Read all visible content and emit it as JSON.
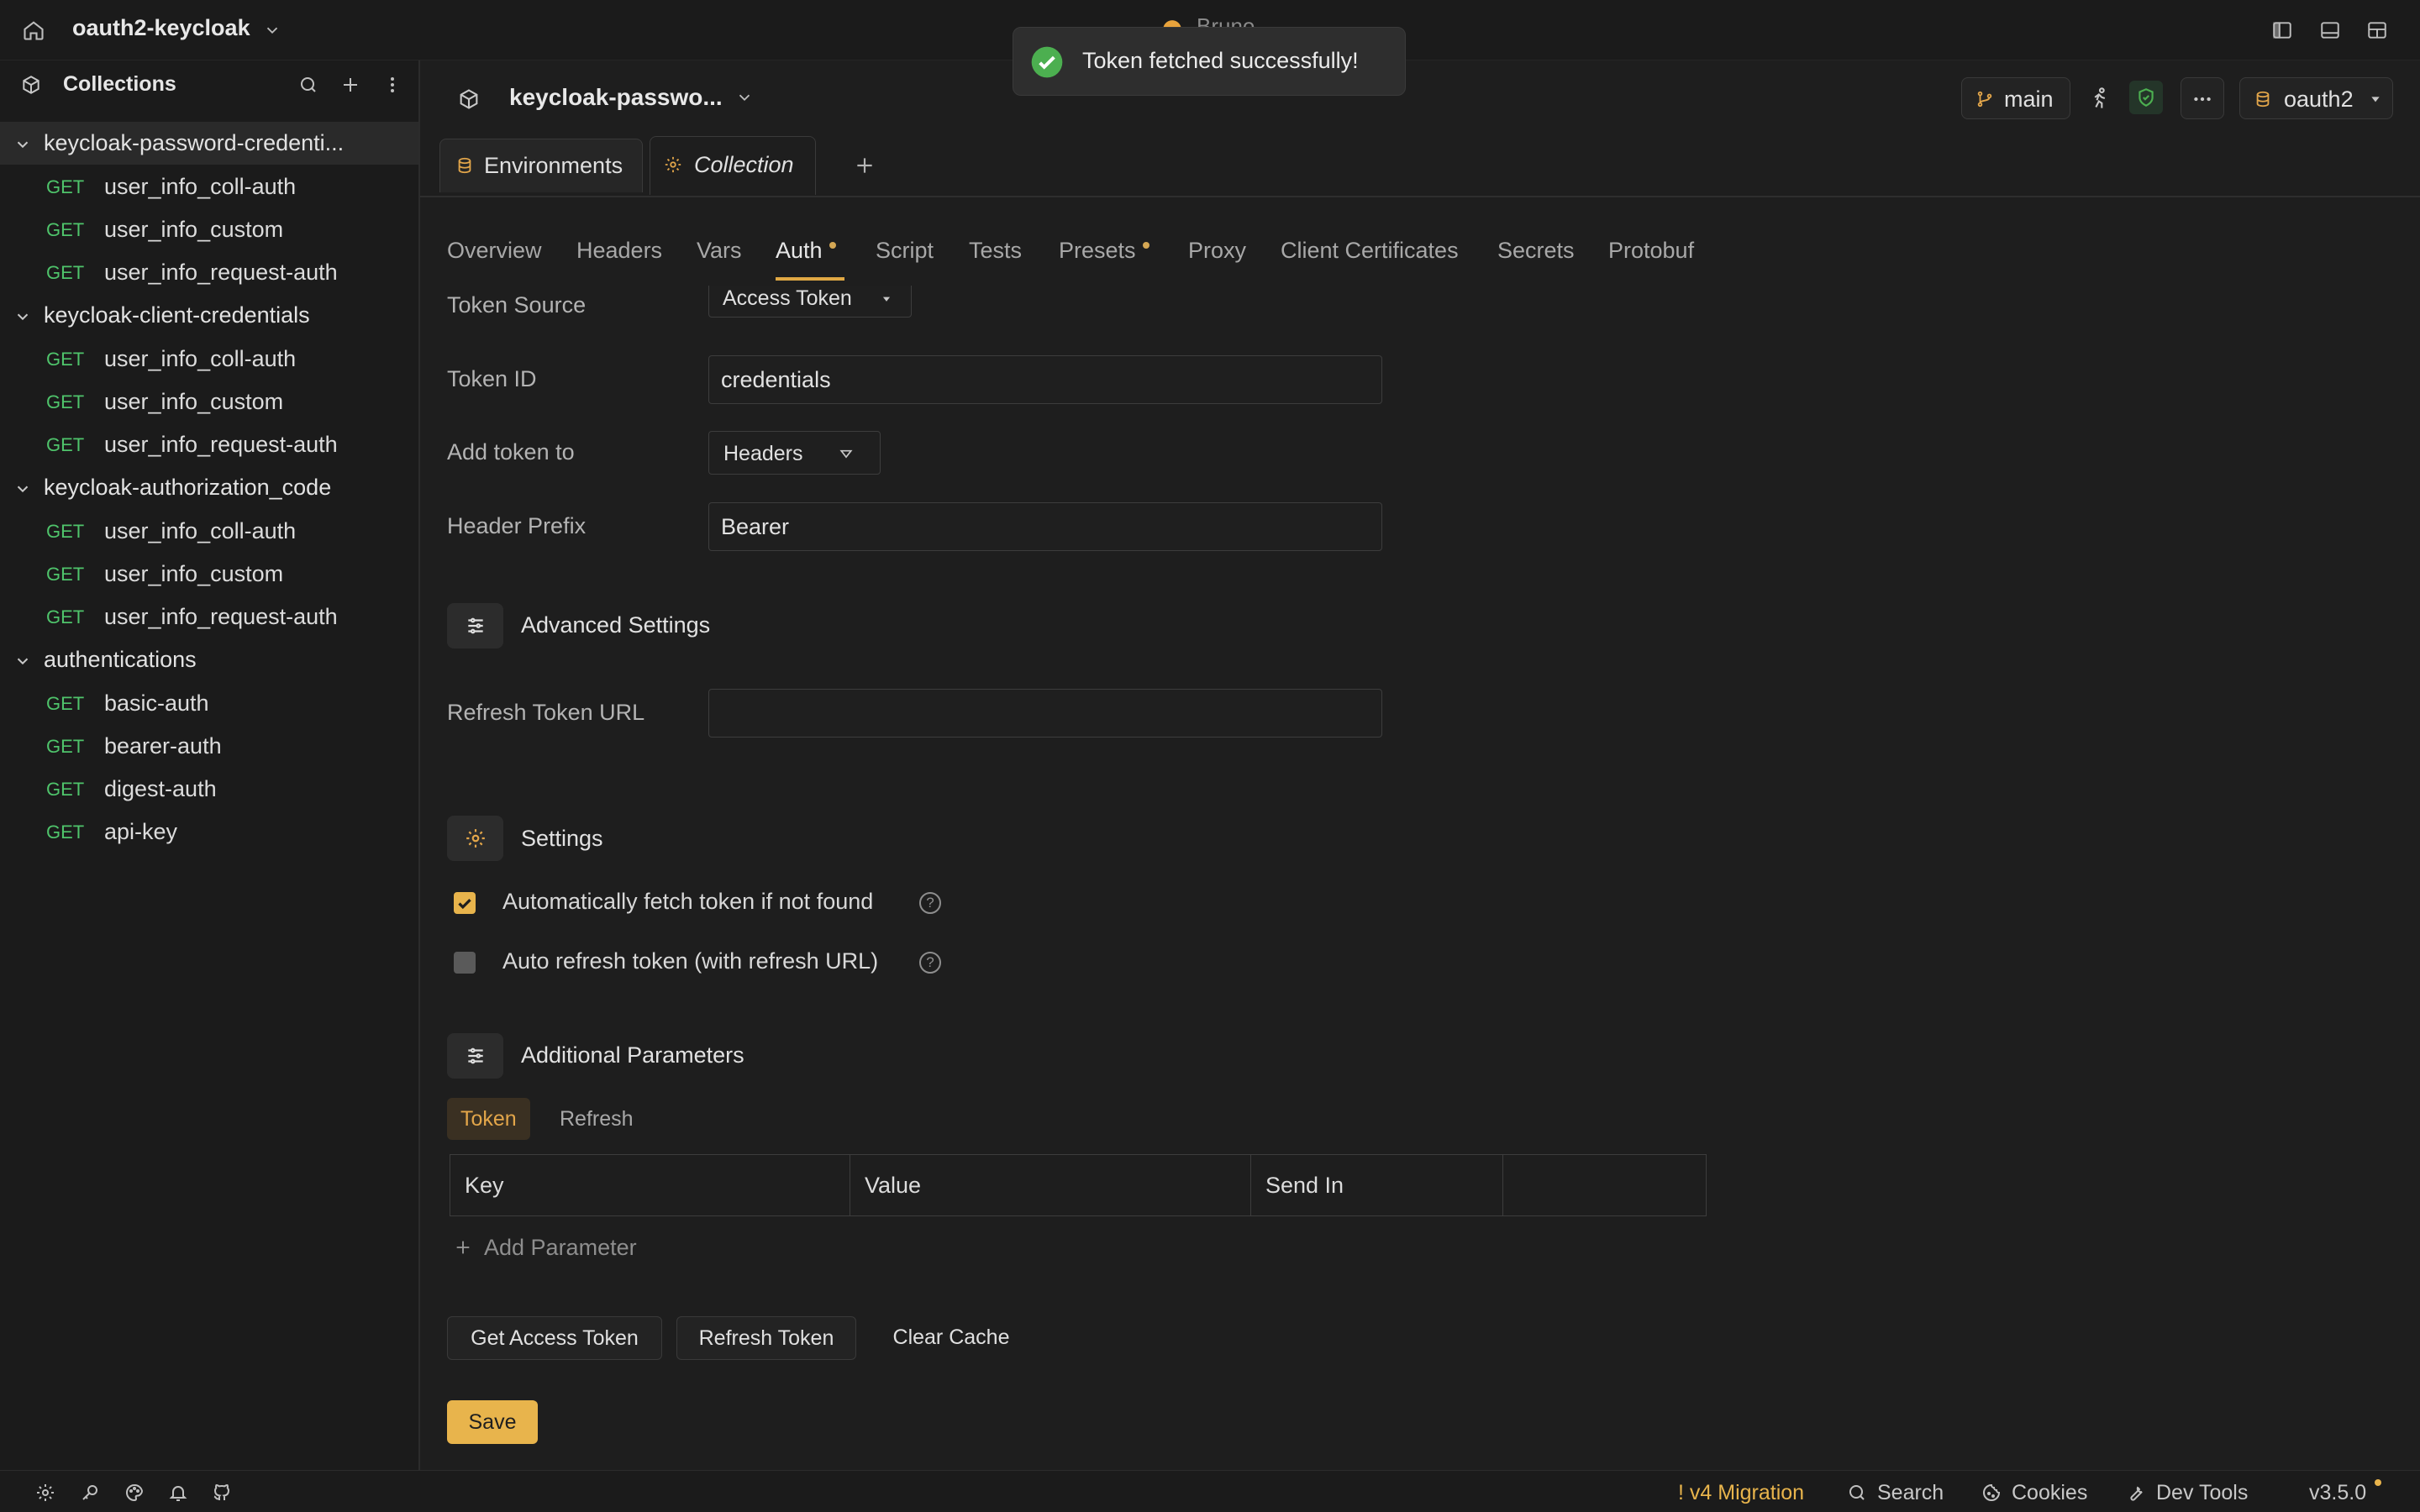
{
  "app": {
    "name": "Bruno",
    "workspace": "oauth2-keycloak"
  },
  "sidebar": {
    "title": "Collections",
    "collections": [
      {
        "name": "keycloak-password-credenti...",
        "selected": true,
        "requests": [
          {
            "method": "GET",
            "name": "user_info_coll-auth"
          },
          {
            "method": "GET",
            "name": "user_info_custom"
          },
          {
            "method": "GET",
            "name": "user_info_request-auth"
          }
        ]
      },
      {
        "name": "keycloak-client-credentials",
        "requests": [
          {
            "method": "GET",
            "name": "user_info_coll-auth"
          },
          {
            "method": "GET",
            "name": "user_info_custom"
          },
          {
            "method": "GET",
            "name": "user_info_request-auth"
          }
        ]
      },
      {
        "name": "keycloak-authorization_code",
        "requests": [
          {
            "method": "GET",
            "name": "user_info_coll-auth"
          },
          {
            "method": "GET",
            "name": "user_info_custom"
          },
          {
            "method": "GET",
            "name": "user_info_request-auth"
          }
        ]
      },
      {
        "name": "authentications",
        "requests": [
          {
            "method": "GET",
            "name": "basic-auth"
          },
          {
            "method": "GET",
            "name": "bearer-auth"
          },
          {
            "method": "GET",
            "name": "digest-auth"
          },
          {
            "method": "GET",
            "name": "api-key"
          }
        ]
      }
    ]
  },
  "header": {
    "collection_name": "keycloak-passwo...",
    "branch": "main",
    "environment": "oauth2"
  },
  "tabs": [
    {
      "label": "Environments",
      "active": false
    },
    {
      "label": "Collection",
      "active": true
    }
  ],
  "settings_nav": [
    {
      "label": "Overview"
    },
    {
      "label": "Headers"
    },
    {
      "label": "Vars"
    },
    {
      "label": "Auth",
      "active": true,
      "modified": true
    },
    {
      "label": "Script"
    },
    {
      "label": "Tests"
    },
    {
      "label": "Presets",
      "modified": true
    },
    {
      "label": "Proxy"
    },
    {
      "label": "Client Certificates"
    },
    {
      "label": "Secrets"
    },
    {
      "label": "Protobuf"
    }
  ],
  "auth": {
    "token_source": {
      "label": "Token Source",
      "value": "Access Token"
    },
    "token_id": {
      "label": "Token ID",
      "value": "credentials"
    },
    "add_token_to": {
      "label": "Add token to",
      "value": "Headers"
    },
    "header_prefix": {
      "label": "Header Prefix",
      "value": "Bearer"
    },
    "advanced_title": "Advanced Settings",
    "refresh_url": {
      "label": "Refresh Token URL",
      "value": ""
    },
    "settings_title": "Settings",
    "auto_fetch": {
      "label": "Automatically fetch token if not found",
      "checked": true
    },
    "auto_refresh": {
      "label": "Auto refresh token (with refresh URL)",
      "checked": false
    },
    "additional_title": "Additional Parameters",
    "param_tabs": [
      "Token",
      "Refresh"
    ],
    "param_columns": [
      "Key",
      "Value",
      "Send In",
      ""
    ],
    "add_param": "Add Parameter",
    "buttons": {
      "get_token": "Get Access Token",
      "refresh_token": "Refresh Token",
      "clear_cache": "Clear Cache"
    },
    "save": "Save"
  },
  "toast": {
    "message": "Token fetched successfully!"
  },
  "statusbar": {
    "migration": "! v4 Migration",
    "search": "Search",
    "cookies": "Cookies",
    "devtools": "Dev Tools",
    "version": "v3.5.0"
  },
  "colors": {
    "accent": "#e8b44c",
    "get_method": "#4fc46b",
    "success": "#4caf50"
  }
}
